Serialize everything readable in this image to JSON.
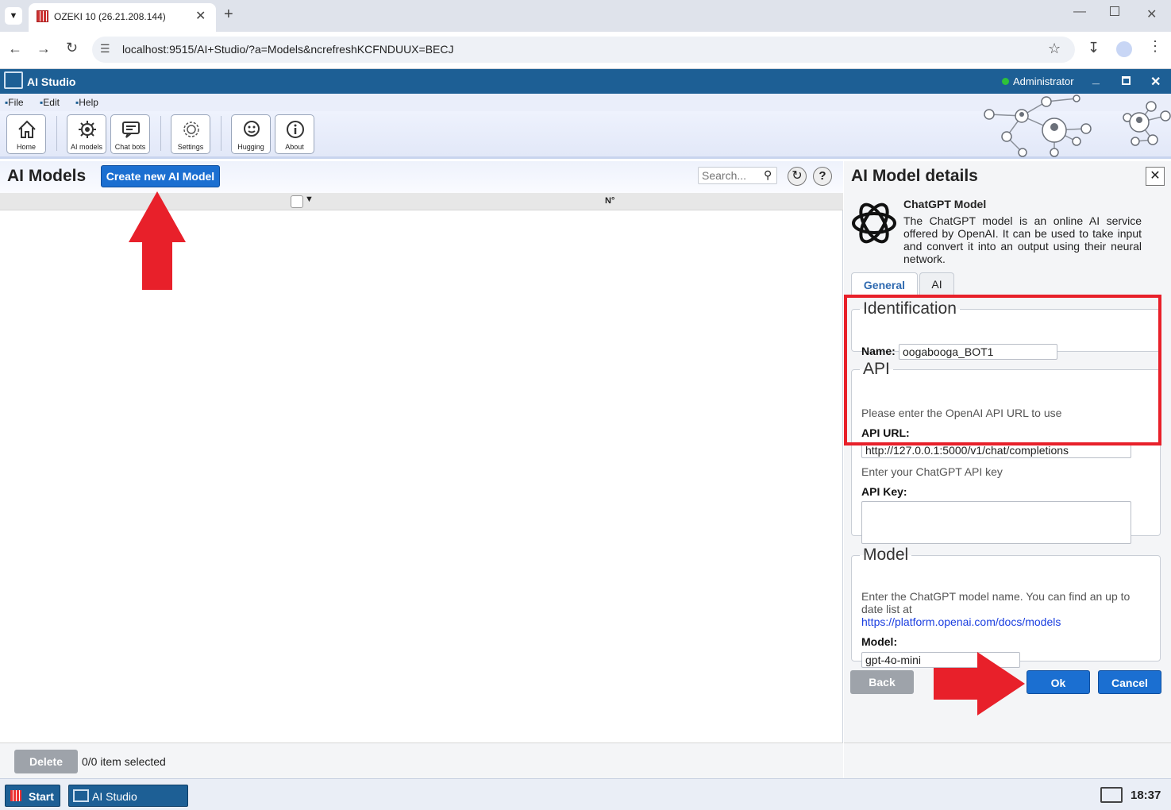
{
  "browser": {
    "tab_title": "OZEKI 10 (26.21.208.144)",
    "url": "localhost:9515/AI+Studio/?a=Models&ncrefreshKCFNDUUX=BECJ"
  },
  "app": {
    "title": "AI Studio",
    "user": "Administrator"
  },
  "menu": [
    "File",
    "Edit",
    "Help"
  ],
  "toolbar": {
    "home": "Home",
    "ai_models": "AI models",
    "chat_bots": "Chat bots",
    "settings": "Settings",
    "hugging": "Hugging",
    "about": "About"
  },
  "left": {
    "title": "AI Models",
    "create_button": "Create new AI Model",
    "search_placeholder": "Search...",
    "col_number": "N°",
    "delete_button": "Delete",
    "selection_status": "0/0 item selected"
  },
  "details": {
    "title": "AI Model details",
    "model_name": "ChatGPT Model",
    "model_desc": "The ChatGPT model is an online AI service offered by OpenAI. It can be used to take input and convert it into an output using their neural network.",
    "tabs": [
      "General",
      "AI"
    ],
    "identification": {
      "legend": "Identification",
      "name_label": "Name:",
      "name_value": "oogabooga_BOT1"
    },
    "api": {
      "legend": "API",
      "url_hint": "Please enter the OpenAI API URL to use",
      "url_label": "API URL:",
      "url_value": "http://127.0.0.1:5000/v1/chat/completions",
      "key_hint": "Enter your ChatGPT API key",
      "key_label": "API Key:",
      "key_value": ""
    },
    "model": {
      "legend": "Model",
      "hint": "Enter the ChatGPT model name. You can find an up to date list at",
      "link": "https://platform.openai.com/docs/models",
      "label": "Model:",
      "value": "gpt-4o-mini"
    },
    "buttons": {
      "back": "Back",
      "ok": "Ok",
      "cancel": "Cancel"
    }
  },
  "taskbar": {
    "start": "Start",
    "app": "AI Studio",
    "clock": "18:37"
  },
  "colors": {
    "header_blue": "#1d5f95",
    "button_blue": "#1b6fd1",
    "highlight_red": "#e8202a"
  }
}
